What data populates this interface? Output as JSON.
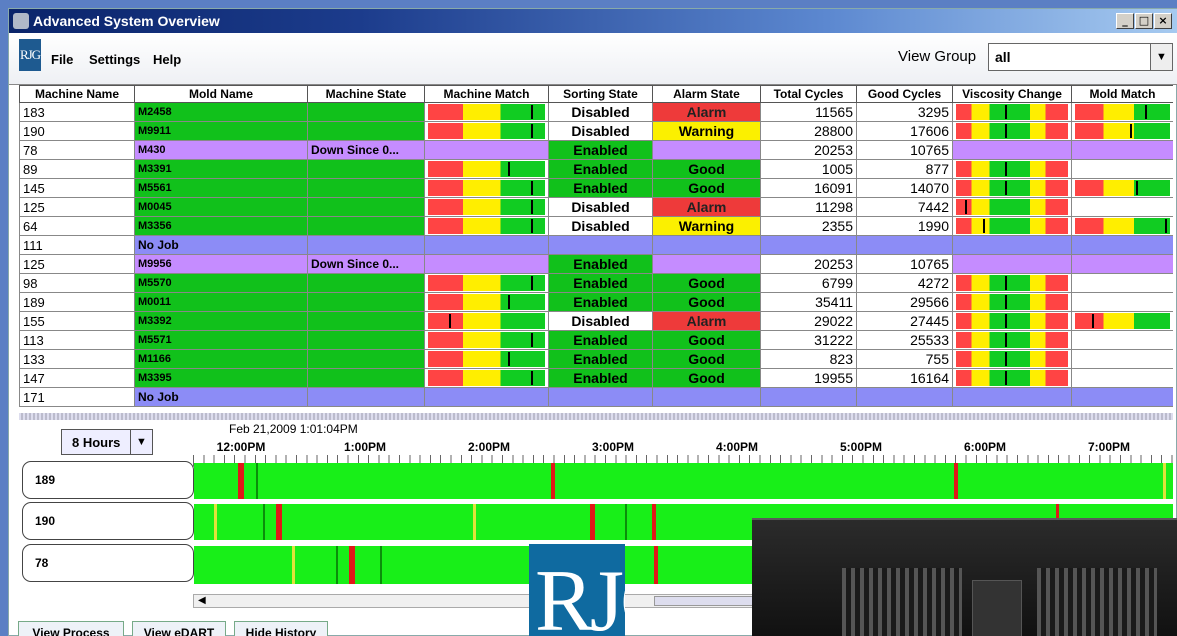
{
  "window": {
    "title": "Advanced System Overview"
  },
  "menu": {
    "logo": "RJG",
    "items": [
      "File",
      "Settings",
      "Help"
    ]
  },
  "view_group": {
    "label": "View Group",
    "value": "all"
  },
  "table": {
    "columns": [
      "Machine Name",
      "Mold Name",
      "Machine State",
      "Machine Match",
      "Sorting State",
      "Alarm State",
      "Total Cycles",
      "Good Cycles",
      "Viscosity Change",
      "Mold Match"
    ],
    "rows": [
      {
        "machine": "183",
        "mold": "M2458",
        "state": "",
        "match": 0.88,
        "sorting": "Disabled",
        "alarm": "Alarm",
        "total": "11565",
        "good": "3295",
        "visc": 0.44,
        "mold_match": 0.74
      },
      {
        "machine": "190",
        "mold": "M9911",
        "state": "",
        "match": 0.88,
        "sorting": "Disabled",
        "alarm": "Warning",
        "total": "28800",
        "good": "17606",
        "visc": 0.44,
        "mold_match": 0.58
      },
      {
        "machine": "78",
        "mold": "M430",
        "state": "Down Since 0...",
        "match": null,
        "sorting": "Enabled",
        "alarm": "",
        "total": "20253",
        "good": "10765",
        "visc": null,
        "mold_match": null
      },
      {
        "machine": "89",
        "mold": "M3391",
        "state": "",
        "match": 0.68,
        "sorting": "Enabled",
        "alarm": "Good",
        "total": "1005",
        "good": "877",
        "visc": 0.44,
        "mold_match": null
      },
      {
        "machine": "145",
        "mold": "M5561",
        "state": "",
        "match": 0.88,
        "sorting": "Enabled",
        "alarm": "Good",
        "total": "16091",
        "good": "14070",
        "visc": 0.44,
        "mold_match": 0.64
      },
      {
        "machine": "125",
        "mold": "M0045",
        "state": "",
        "match": 0.88,
        "sorting": "Disabled",
        "alarm": "Alarm",
        "total": "11298",
        "good": "7442",
        "visc": 0.08,
        "mold_match": null
      },
      {
        "machine": "64",
        "mold": "M3356",
        "state": "",
        "match": 0.88,
        "sorting": "Disabled",
        "alarm": "Warning",
        "total": "2355",
        "good": "1990",
        "visc": 0.24,
        "mold_match": 0.95
      },
      {
        "machine": "111",
        "mold": "No Job",
        "state": "",
        "match": null,
        "sorting": "",
        "alarm": "",
        "total": "",
        "good": "",
        "visc": null,
        "mold_match": null
      },
      {
        "machine": "125",
        "mold": "M9956",
        "state": "Down Since 0...",
        "match": null,
        "sorting": "Enabled",
        "alarm": "",
        "total": "20253",
        "good": "10765",
        "visc": null,
        "mold_match": null
      },
      {
        "machine": "98",
        "mold": "M5570",
        "state": "",
        "match": 0.88,
        "sorting": "Enabled",
        "alarm": "Good",
        "total": "6799",
        "good": "4272",
        "visc": 0.44,
        "mold_match": null
      },
      {
        "machine": "189",
        "mold": "M0011",
        "state": "",
        "match": 0.68,
        "sorting": "Enabled",
        "alarm": "Good",
        "total": "35411",
        "good": "29566",
        "visc": 0.44,
        "mold_match": null
      },
      {
        "machine": "155",
        "mold": "M3392",
        "state": "",
        "match": 0.18,
        "sorting": "Disabled",
        "alarm": "Alarm",
        "total": "29022",
        "good": "27445",
        "visc": 0.44,
        "mold_match": 0.18
      },
      {
        "machine": "113",
        "mold": "M5571",
        "state": "",
        "match": 0.88,
        "sorting": "Enabled",
        "alarm": "Good",
        "total": "31222",
        "good": "25533",
        "visc": 0.44,
        "mold_match": null
      },
      {
        "machine": "133",
        "mold": "M1166",
        "state": "",
        "match": 0.68,
        "sorting": "Enabled",
        "alarm": "Good",
        "total": "823",
        "good": "755",
        "visc": 0.44,
        "mold_match": null
      },
      {
        "machine": "147",
        "mold": "M3395",
        "state": "",
        "match": 0.88,
        "sorting": "Enabled",
        "alarm": "Good",
        "total": "19955",
        "good": "16164",
        "visc": 0.44,
        "mold_match": null
      },
      {
        "machine": "171",
        "mold": "No Job",
        "state": "",
        "match": null,
        "sorting": "",
        "alarm": "",
        "total": "",
        "good": "",
        "visc": null,
        "mold_match": null
      }
    ]
  },
  "history": {
    "hours_select": "8 Hours",
    "timestamp": "Feb 21,2009  1:01:04PM",
    "times": [
      "12:00PM",
      "1:00PM",
      "2:00PM",
      "3:00PM",
      "4:00PM",
      "5:00PM",
      "6:00PM",
      "7:00PM"
    ],
    "machines": [
      {
        "label": "189",
        "marks": [
          [
            0.045,
            0.006,
            "#e01818"
          ],
          [
            0.063,
            0.002,
            "#0b8e0b"
          ],
          [
            0.365,
            0.004,
            "#e01818"
          ],
          [
            0.776,
            0.004,
            "#e01818"
          ],
          [
            0.99,
            0.003,
            "#dfe33a"
          ]
        ]
      },
      {
        "label": "190",
        "marks": [
          [
            0.02,
            0.003,
            "#dfe33a"
          ],
          [
            0.07,
            0.002,
            "#0b8e0b"
          ],
          [
            0.084,
            0.006,
            "#e01818"
          ],
          [
            0.285,
            0.003,
            "#dfe33a"
          ],
          [
            0.405,
            0.005,
            "#e01818"
          ],
          [
            0.44,
            0.002,
            "#0b8e0b"
          ],
          [
            0.468,
            0.004,
            "#e01818"
          ],
          [
            0.88,
            0.004,
            "#e01818"
          ]
        ]
      },
      {
        "label": "78",
        "marks": [
          [
            0.1,
            0.003,
            "#dfe33a"
          ],
          [
            0.145,
            0.002,
            "#0b8e0b"
          ],
          [
            0.158,
            0.006,
            "#e01818"
          ],
          [
            0.19,
            0.002,
            "#0b8e0b"
          ],
          [
            0.47,
            0.004,
            "#e01818"
          ]
        ]
      }
    ]
  },
  "buttons": [
    "View Process",
    "View eDART",
    "Hide History"
  ],
  "big_logo": "RJG",
  "colors": {
    "green": "#11c11b",
    "purple": "#c58cff",
    "blue": "#8c8cf6",
    "red": "#ee3a3a",
    "yellow": "#fbf000",
    "history_green": "#18ef18"
  }
}
